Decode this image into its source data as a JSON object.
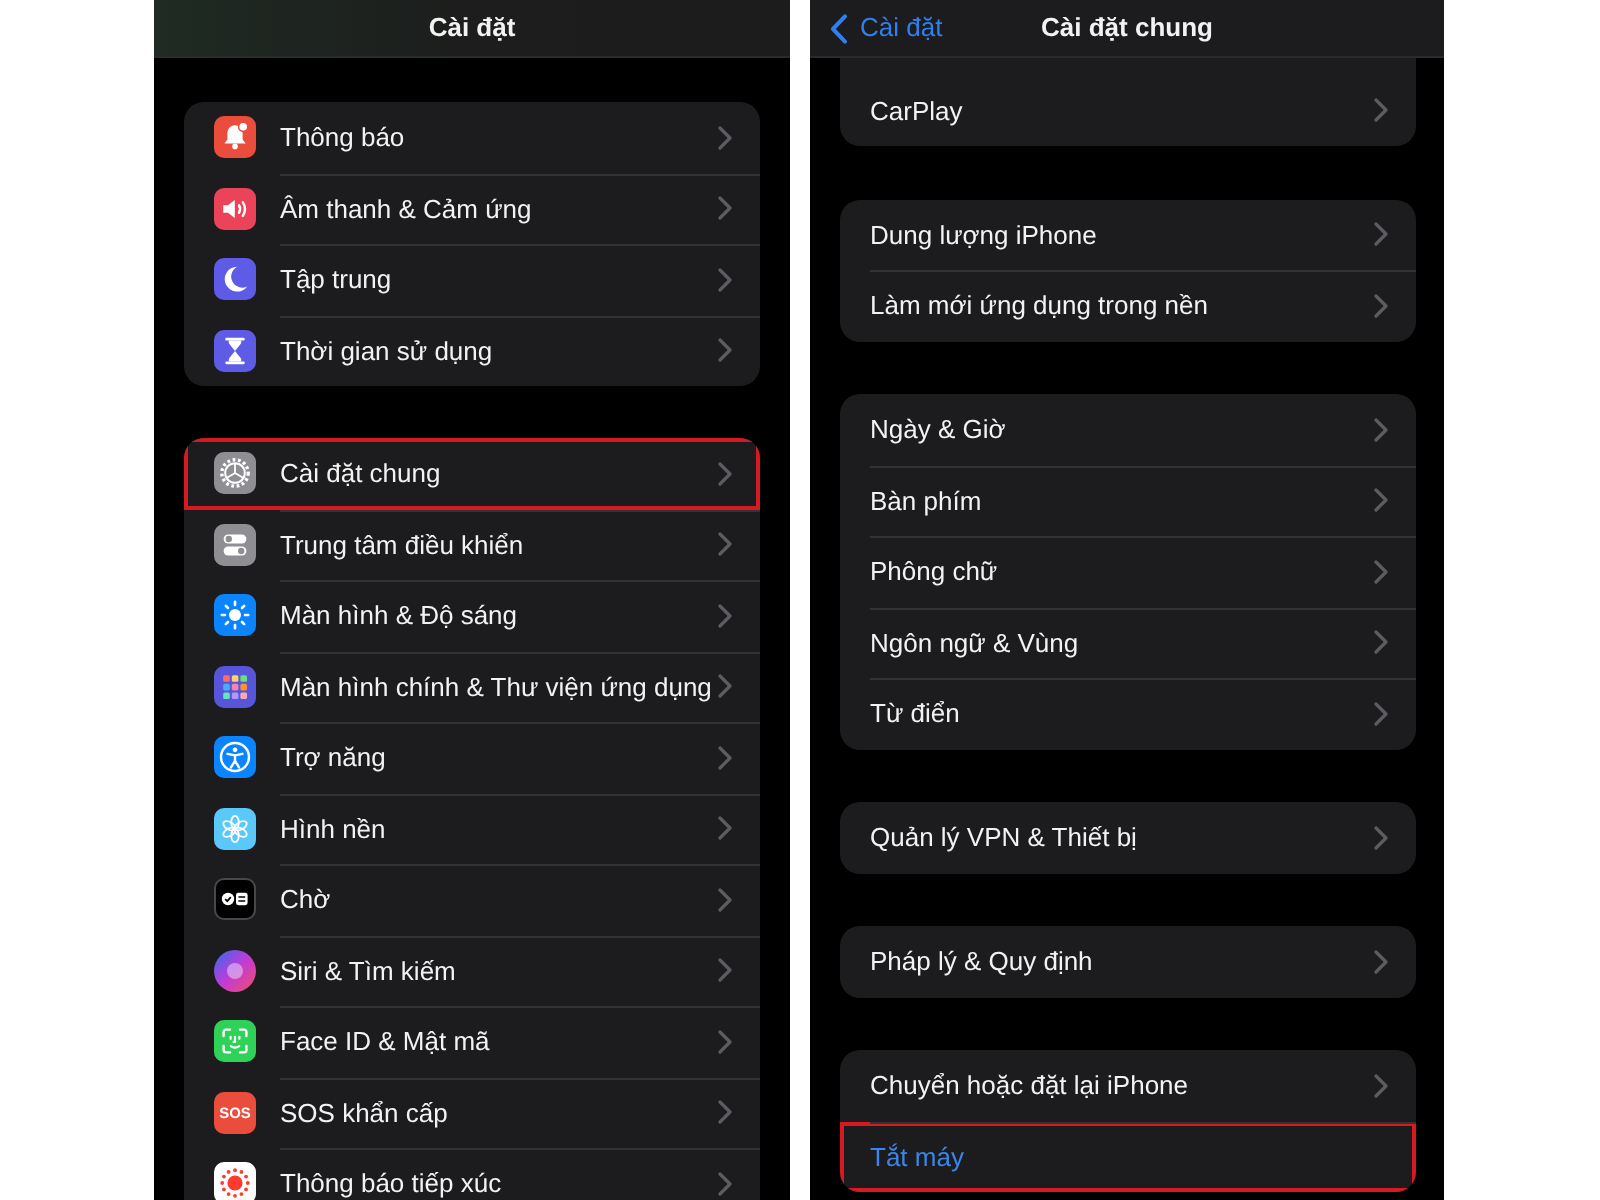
{
  "screens": [
    {
      "header": {
        "title": "Cài đặt"
      },
      "groups": [
        {
          "items": [
            {
              "label": "Thông báo",
              "kind": "icon_link",
              "highlighted": false
            },
            {
              "label": "Âm thanh & Cảm ứng",
              "kind": "icon_link",
              "highlighted": false
            },
            {
              "label": "Tập trung",
              "kind": "icon_link",
              "highlighted": false
            },
            {
              "label": "Thời gian sử dụng",
              "kind": "icon_link",
              "highlighted": false
            }
          ]
        },
        {
          "items": [
            {
              "label": "Cài đặt chung",
              "kind": "icon_link",
              "highlighted": true
            },
            {
              "label": "Trung tâm điều khiển",
              "kind": "icon_link",
              "highlighted": false
            },
            {
              "label": "Màn hình & Độ sáng",
              "kind": "icon_link",
              "highlighted": false
            },
            {
              "label": "Màn hình chính & Thư viện ứng dụng",
              "kind": "icon_link",
              "highlighted": false
            },
            {
              "label": "Trợ năng",
              "kind": "icon_link",
              "highlighted": false
            },
            {
              "label": "Hình nền",
              "kind": "icon_link",
              "highlighted": false
            },
            {
              "label": "Chờ",
              "kind": "icon_link",
              "highlighted": false
            },
            {
              "label": "Siri & Tìm kiếm",
              "kind": "icon_link",
              "highlighted": false
            },
            {
              "label": "Face ID & Mật mã",
              "kind": "icon_link",
              "highlighted": false
            },
            {
              "label": "SOS khẩn cấp",
              "kind": "icon_link",
              "icon_text": "SOS",
              "highlighted": false
            },
            {
              "label": "Thông báo tiếp xúc",
              "kind": "icon_link",
              "highlighted": false
            }
          ]
        }
      ]
    },
    {
      "header": {
        "back": "Cài đặt",
        "title": "Cài đặt chung"
      },
      "groups": [
        {
          "items": [
            {
              "label": "CarPlay",
              "kind": "link",
              "highlighted": false
            }
          ]
        },
        {
          "items": [
            {
              "label": "Dung lượng iPhone",
              "kind": "link",
              "highlighted": false
            },
            {
              "label": "Làm mới ứng dụng trong nền",
              "kind": "link",
              "highlighted": false
            }
          ]
        },
        {
          "items": [
            {
              "label": "Ngày & Giờ",
              "kind": "link",
              "highlighted": false
            },
            {
              "label": "Bàn phím",
              "kind": "link",
              "highlighted": false
            },
            {
              "label": "Phông chữ",
              "kind": "link",
              "highlighted": false
            },
            {
              "label": "Ngôn ngữ & Vùng",
              "kind": "link",
              "highlighted": false
            },
            {
              "label": "Từ điển",
              "kind": "link",
              "highlighted": false
            }
          ]
        },
        {
          "items": [
            {
              "label": "Quản lý VPN & Thiết bị",
              "kind": "link",
              "highlighted": false
            }
          ]
        },
        {
          "items": [
            {
              "label": "Pháp lý & Quy định",
              "kind": "link",
              "highlighted": false
            }
          ]
        },
        {
          "items": [
            {
              "label": "Chuyển hoặc đặt lại iPhone",
              "kind": "link",
              "highlighted": false
            },
            {
              "label": "Tắt máy",
              "kind": "action",
              "highlighted": true
            }
          ]
        }
      ]
    }
  ]
}
